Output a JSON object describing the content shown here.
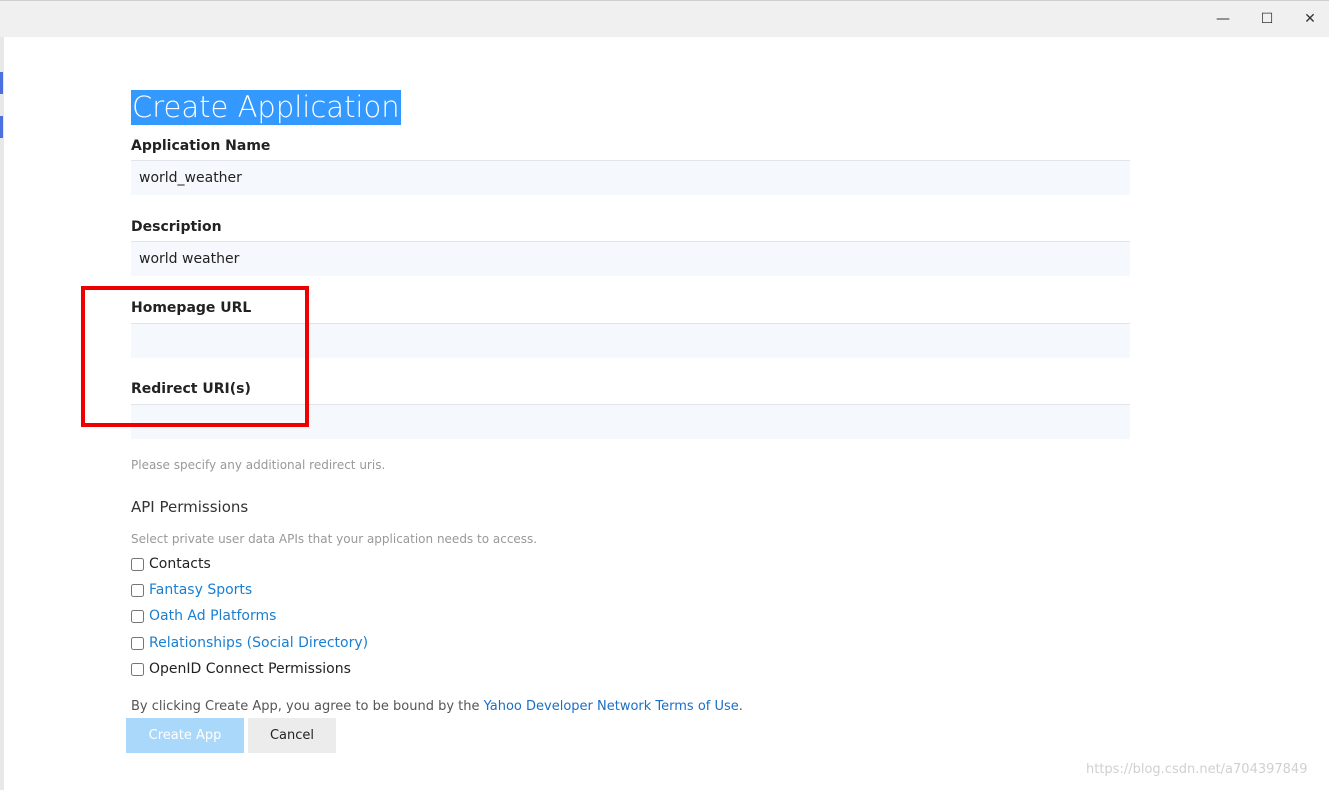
{
  "window": {
    "controls": {
      "minimize": "—",
      "maximize": "☐",
      "close": "✕"
    }
  },
  "form": {
    "title": "Create Application",
    "application_name": {
      "label": "Application Name",
      "value": "world_weather"
    },
    "description": {
      "label": "Description",
      "value": "world weather"
    },
    "homepage_url": {
      "label": "Homepage URL",
      "value": ""
    },
    "redirect_uris": {
      "label": "Redirect URI(s)",
      "value": "",
      "hint": "Please specify any additional redirect uris."
    },
    "api_permissions": {
      "title": "API Permissions",
      "hint": "Select private user data APIs that your application needs to access.",
      "items": [
        {
          "label": "Contacts",
          "checked": false,
          "link": false
        },
        {
          "label": "Fantasy Sports",
          "checked": false,
          "link": true
        },
        {
          "label": "Oath Ad Platforms",
          "checked": false,
          "link": true
        },
        {
          "label": "Relationships (Social Directory)",
          "checked": false,
          "link": true
        },
        {
          "label": "OpenID Connect Permissions",
          "checked": false,
          "link": false
        }
      ]
    },
    "agreement": {
      "prefix": "By clicking Create App, you agree to be bound by the ",
      "link": "Yahoo Developer Network Terms of Use",
      "suffix": "."
    },
    "buttons": {
      "create": "Create App",
      "cancel": "Cancel"
    }
  },
  "watermark": "https://blog.csdn.net/a704397849",
  "colors": {
    "title_highlight": "#3399ff",
    "link": "#1a7fd1",
    "annotation": "#ee0000",
    "create_button": "#a9d8fb"
  }
}
